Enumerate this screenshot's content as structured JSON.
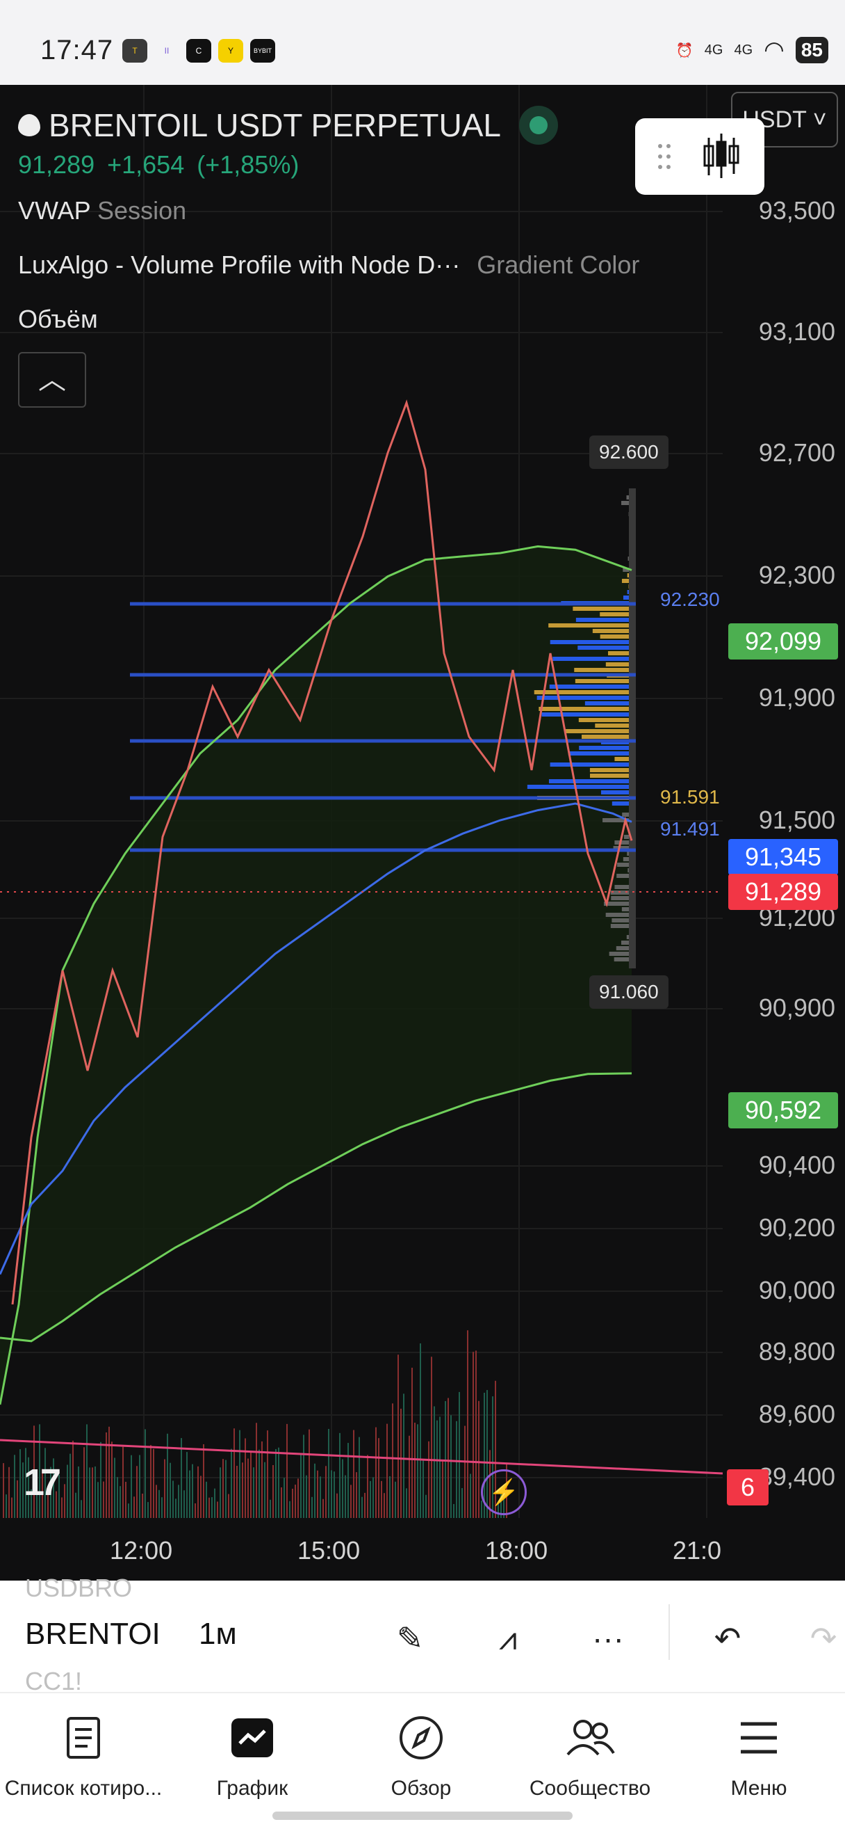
{
  "status_bar": {
    "time": "17:47",
    "app_icons": [
      "T",
      "II",
      "C",
      "Y",
      "BYBIT"
    ],
    "signal_1": "4G",
    "signal_2": "4G",
    "battery": "85"
  },
  "chart_header": {
    "symbol_title": "BRENTOIL USDT PERPETUAL",
    "last_price": "91,289",
    "change": "+1,654",
    "change_pct": "(+1,85%)",
    "currency_button": "USDT",
    "indicator_1_name": "VWAP",
    "indicator_1_param": "Session",
    "indicator_2_name": "LuxAlgo - Volume Profile with Node D···",
    "indicator_2_param": "Gradient Color",
    "indicator_3_name": "Объём",
    "collapse_icon": "chevron-up"
  },
  "chart_data": {
    "type": "line",
    "series": [
      {
        "name": "Price",
        "color": "#ef5350"
      },
      {
        "name": "VWAP",
        "color": "#3d6be8"
      }
    ],
    "y_ticks": [
      "93,500",
      "93,100",
      "92,700",
      "92,300",
      "91,900",
      "91,500",
      "91,200",
      "90,900",
      "90,400",
      "90,200",
      "90,000",
      "89,800",
      "89,600",
      "89,400"
    ],
    "x_ticks": [
      "12:00",
      "15:00",
      "18:00",
      "21:0"
    ],
    "price_tags": [
      {
        "value": "92,099",
        "color": "#4caf50"
      },
      {
        "value": "91,345",
        "color": "#2962ff"
      },
      {
        "value": "91,289",
        "color": "#f23645"
      },
      {
        "value": "90,592",
        "color": "#4caf50"
      },
      {
        "value": "6",
        "color": "#f23645"
      }
    ],
    "profile_high": "92.600",
    "profile_low": "91.060",
    "node_labels": [
      {
        "value": "92.230",
        "color": "#2962ff"
      },
      {
        "value": "91.591",
        "color": "#e0b84a"
      },
      {
        "value": "91.491",
        "color": "#2962ff"
      }
    ],
    "price_path": [
      [
        90.2,
        89900
      ],
      [
        90.5,
        90400
      ],
      [
        91.0,
        90900
      ],
      [
        91.4,
        90600
      ],
      [
        91.8,
        90900
      ],
      [
        92.2,
        90700
      ],
      [
        92.6,
        91300
      ],
      [
        93.0,
        91500
      ],
      [
        93.4,
        91750
      ],
      [
        93.8,
        91600
      ],
      [
        94.3,
        91800
      ],
      [
        94.8,
        91650
      ],
      [
        95.3,
        91950
      ],
      [
        95.8,
        92200
      ],
      [
        96.2,
        92450
      ],
      [
        96.5,
        92600
      ],
      [
        96.8,
        92400
      ],
      [
        97.1,
        91850
      ],
      [
        97.5,
        91600
      ],
      [
        97.9,
        91500
      ],
      [
        98.2,
        91800
      ],
      [
        98.5,
        91500
      ],
      [
        98.8,
        91850
      ],
      [
        99.1,
        91550
      ],
      [
        99.4,
        91250
      ],
      [
        99.7,
        91100
      ],
      [
        100.0,
        91350
      ],
      [
        100.1,
        91289
      ]
    ],
    "vwap_path": [
      [
        90.0,
        89990
      ],
      [
        90.5,
        90200
      ],
      [
        91.0,
        90300
      ],
      [
        91.5,
        90450
      ],
      [
        92.0,
        90550
      ],
      [
        92.6,
        90650
      ],
      [
        93.2,
        90750
      ],
      [
        93.8,
        90850
      ],
      [
        94.4,
        90950
      ],
      [
        95.0,
        91030
      ],
      [
        95.6,
        91110
      ],
      [
        96.2,
        91190
      ],
      [
        96.8,
        91260
      ],
      [
        97.4,
        91310
      ],
      [
        98.0,
        91350
      ],
      [
        98.6,
        91380
      ],
      [
        99.2,
        91400
      ],
      [
        99.8,
        91370
      ],
      [
        100.1,
        91345
      ]
    ],
    "upper_band": [
      [
        90.0,
        89600
      ],
      [
        90.3,
        89900
      ],
      [
        90.6,
        90400
      ],
      [
        91.0,
        90900
      ],
      [
        91.5,
        91100
      ],
      [
        92.0,
        91250
      ],
      [
        92.6,
        91400
      ],
      [
        93.2,
        91550
      ],
      [
        93.8,
        91650
      ],
      [
        94.4,
        91800
      ],
      [
        95.0,
        91900
      ],
      [
        95.6,
        92000
      ],
      [
        96.2,
        92080
      ],
      [
        96.8,
        92130
      ],
      [
        97.4,
        92140
      ],
      [
        98.0,
        92150
      ],
      [
        98.6,
        92170
      ],
      [
        99.2,
        92160
      ],
      [
        100.1,
        92099
      ]
    ],
    "lower_band": [
      [
        90.0,
        89800
      ],
      [
        90.5,
        89790
      ],
      [
        91.0,
        89850
      ],
      [
        91.6,
        89930
      ],
      [
        92.2,
        90000
      ],
      [
        92.8,
        90070
      ],
      [
        93.4,
        90130
      ],
      [
        94.0,
        90190
      ],
      [
        94.6,
        90260
      ],
      [
        95.2,
        90320
      ],
      [
        95.8,
        90380
      ],
      [
        96.4,
        90430
      ],
      [
        97.0,
        90470
      ],
      [
        97.6,
        90510
      ],
      [
        98.2,
        90540
      ],
      [
        98.8,
        90570
      ],
      [
        99.4,
        90590
      ],
      [
        100.1,
        90592
      ]
    ]
  },
  "toolbar": {
    "ghost_above": "USDBRO",
    "symbol": "BRENTOI",
    "ghost_below": "CC1!",
    "interval": "1м"
  },
  "bottom_nav": [
    {
      "label": "Список котиро...",
      "icon": "watchlist-icon"
    },
    {
      "label": "График",
      "icon": "chart-icon"
    },
    {
      "label": "Обзор",
      "icon": "compass-icon"
    },
    {
      "label": "Сообщество",
      "icon": "community-icon"
    },
    {
      "label": "Меню",
      "icon": "menu-icon"
    }
  ]
}
